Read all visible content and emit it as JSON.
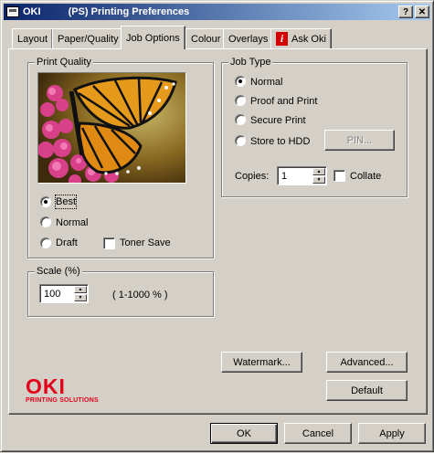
{
  "window": {
    "brand": "OKI",
    "title": "(PS) Printing Preferences",
    "help_label": "?",
    "close_label": "✕"
  },
  "tabs": [
    {
      "label": "Layout"
    },
    {
      "label": "Paper/Quality"
    },
    {
      "label": "Job Options"
    },
    {
      "label": "Colour"
    },
    {
      "label": "Overlays"
    },
    {
      "label": "Ask Oki"
    }
  ],
  "active_tab": "Job Options",
  "print_quality": {
    "legend": "Print Quality",
    "options": [
      {
        "label": "Best",
        "selected": true
      },
      {
        "label": "Normal",
        "selected": false
      },
      {
        "label": "Draft",
        "selected": false
      }
    ],
    "toner_save": {
      "label": "Toner Save",
      "checked": false
    }
  },
  "scale": {
    "legend": "Scale (%)",
    "value": "100",
    "range_text": "( 1-1000 % )"
  },
  "job_type": {
    "legend": "Job Type",
    "options": [
      {
        "label": "Normal",
        "selected": true
      },
      {
        "label": "Proof and Print",
        "selected": false
      },
      {
        "label": "Secure Print",
        "selected": false
      },
      {
        "label": "Store to HDD",
        "selected": false
      }
    ],
    "pin_label": "PIN...",
    "copies_label": "Copies:",
    "copies_value": "1",
    "collate": {
      "label": "Collate",
      "checked": false
    }
  },
  "buttons": {
    "watermark": "Watermark...",
    "advanced": "Advanced...",
    "default": "Default",
    "ok": "OK",
    "cancel": "Cancel",
    "apply": "Apply"
  },
  "logo": {
    "name": "OKI",
    "tagline": "PRINTING SOLUTIONS"
  },
  "colors": {
    "titlebar_start": "#0a246a",
    "titlebar_end": "#a6caf0",
    "brand_red": "#e2001a",
    "face": "#d4d0c8"
  }
}
